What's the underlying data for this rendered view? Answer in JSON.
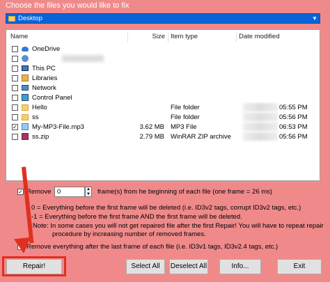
{
  "window": {
    "title": "Choose the files you would like to fix"
  },
  "folder_select": {
    "value": "Desktop"
  },
  "file_list": {
    "columns": [
      "Name",
      "Size",
      "Item type",
      "Date modified"
    ],
    "rows": [
      {
        "name": "OneDrive",
        "size": "",
        "type": "",
        "date": "",
        "icon": "cloud-icon",
        "checked": false
      },
      {
        "name": "",
        "size": "",
        "type": "",
        "date": "",
        "icon": "user-icon",
        "checked": false
      },
      {
        "name": "This PC",
        "size": "",
        "type": "",
        "date": "",
        "icon": "pc-icon",
        "checked": false
      },
      {
        "name": "Libraries",
        "size": "",
        "type": "",
        "date": "",
        "icon": "library-icon",
        "checked": false
      },
      {
        "name": "Network",
        "size": "",
        "type": "",
        "date": "",
        "icon": "network-icon",
        "checked": false
      },
      {
        "name": "Control Panel",
        "size": "",
        "type": "",
        "date": "",
        "icon": "control-panel-icon",
        "checked": false
      },
      {
        "name": "Hello",
        "size": "",
        "type": "File folder",
        "date": "05:55 PM",
        "icon": "folder-icon",
        "checked": false
      },
      {
        "name": "ss",
        "size": "",
        "type": "File folder",
        "date": "05:56 PM",
        "icon": "folder-icon",
        "checked": false
      },
      {
        "name": "My-MP3-File.mp3",
        "size": "3.62 MB",
        "type": "MP3 File",
        "date": "06:53 PM",
        "icon": "mp3-file-icon",
        "checked": true
      },
      {
        "name": "ss.zip",
        "size": "2.79 MB",
        "type": "WinRAR ZIP archive",
        "date": "05:56 PM",
        "icon": "zip-file-icon",
        "checked": false
      }
    ]
  },
  "options": {
    "remove_label": "Remove",
    "remove_value": "0",
    "remove_suffix": "frame(s) from he beginning of each file (one frame = 26 ms)",
    "note1": "0  = Everything before the first frame will be deleted (i.e. ID3v2 tags, corrupt ID3v2 tags, etc.)",
    "note2": "-1 = Everything before the first frame AND the first frame will be deleted.",
    "note3": "Note: In some cases you will not get repaired file after the first Repair! You will have to repeat repair",
    "note4": "procedure by increasing number of removed frames.",
    "remove_last_label": "Remove everything after the last frame of each file (i.e. ID3v1 tags, ID3v2.4 tags, etc.)"
  },
  "buttons": {
    "repair": "Repair!",
    "select_all": "Select All",
    "deselect_all": "Deselect All",
    "info": "Info...",
    "exit": "Exit"
  },
  "colors": {
    "background": "#f08a8a",
    "accent": "#0a64d8",
    "highlight": "#e03020"
  }
}
